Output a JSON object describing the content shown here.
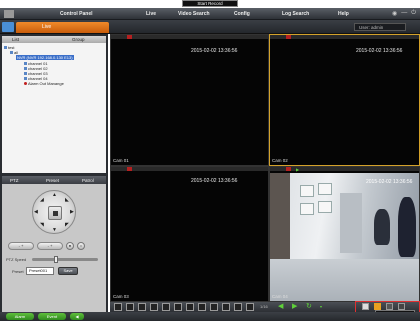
{
  "tooltip_top": "Start Record",
  "menu": {
    "items": [
      "Control Panel",
      "Live",
      "Video Search",
      "Config",
      "Log Search",
      "Help"
    ]
  },
  "subbar": {
    "live_tab": "Live",
    "user": "User: admin"
  },
  "tree": {
    "header_list": "List",
    "header_group": "Group",
    "nodes": [
      {
        "label": "test",
        "level": 0
      },
      {
        "label": "all",
        "level": 1
      },
      {
        "label": "NVR (NVR 192.168.0.130 E13)",
        "level": 2,
        "selected": true
      },
      {
        "label": "channel 01",
        "level": 3
      },
      {
        "label": "channel 02",
        "level": 3
      },
      {
        "label": "channel 03",
        "level": 3
      },
      {
        "label": "channel 04",
        "level": 3
      },
      {
        "label": "Alarm Out Manange",
        "level": 3
      }
    ]
  },
  "ptz": {
    "tabs": [
      "PTZ",
      "Preset",
      "Patrol"
    ],
    "speed_label": "PTZ Speed",
    "preset_label": "Preset",
    "preset_value": "Preset001",
    "save_label": "Save",
    "zoom_in": "+",
    "zoom_out": "-"
  },
  "status": {
    "alarm": "Alarm",
    "event": "Event"
  },
  "cameras": [
    {
      "name": "Cam 01",
      "timestamp": "2015-02-02 13:36:56"
    },
    {
      "name": "Cam 02",
      "timestamp": "2015-02-02 13:36:56"
    },
    {
      "name": "Cam 03",
      "timestamp": "2015-02-02 13:36:56"
    },
    {
      "name": "Cam 04",
      "timestamp": "2015-02-02 13:36:56"
    }
  ],
  "toolbar": {
    "speed_text": "1/16"
  },
  "tooltip_bottom": "Start Record",
  "colors": {
    "accent_orange": "#e07a1f",
    "active_border": "#d4a22a",
    "record_red": "#c02020",
    "green": "#5fd13a"
  }
}
